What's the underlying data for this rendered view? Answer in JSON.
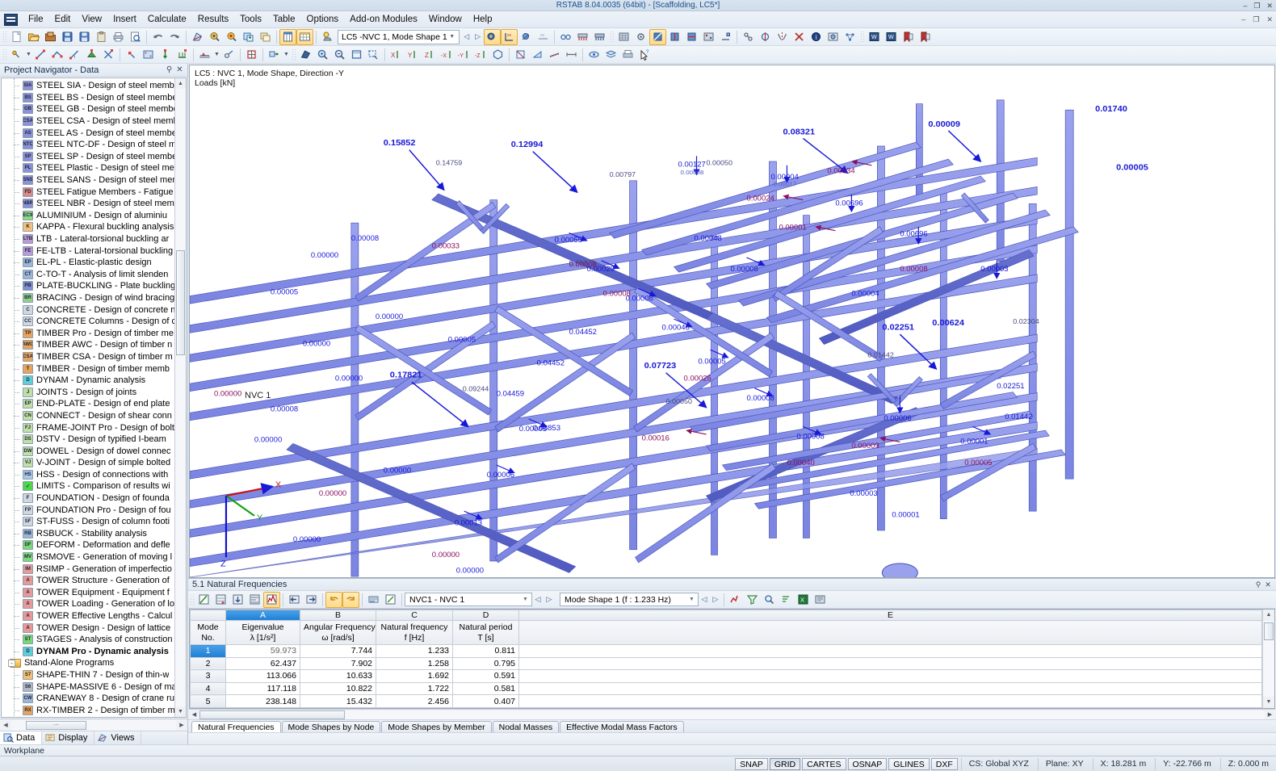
{
  "window": {
    "title": "RSTAB 8.04.0035 (64bit) - [Scaffolding, LC5*]",
    "minimize": "–",
    "maximize": "❐",
    "close": "✕",
    "doc_minimize": "–",
    "doc_maximize": "❐",
    "doc_close": "✕"
  },
  "menu": {
    "items": [
      {
        "label": "File"
      },
      {
        "label": "Edit"
      },
      {
        "label": "View"
      },
      {
        "label": "Insert"
      },
      {
        "label": "Calculate"
      },
      {
        "label": "Results"
      },
      {
        "label": "Tools"
      },
      {
        "label": "Table"
      },
      {
        "label": "Options"
      },
      {
        "label": "Add-on Modules"
      },
      {
        "label": "Window"
      },
      {
        "label": "Help"
      }
    ]
  },
  "toolbar_main": {
    "load_case_combo": "LC5 -NVC 1, Mode Shape 1",
    "buttons": [
      {
        "name": "new-document-icon"
      },
      {
        "name": "open-folder-icon"
      },
      {
        "name": "open-recent-icon"
      },
      {
        "name": "save-as-icon"
      },
      {
        "name": "save-icon"
      },
      {
        "name": "clipboard-icon"
      },
      {
        "name": "print-icon"
      },
      {
        "name": "print-preview-icon"
      },
      {
        "name": "undo-icon"
      },
      {
        "name": "redo-icon"
      },
      {
        "name": "render-icon"
      },
      {
        "name": "zoom-model-icon"
      },
      {
        "name": "zoom-results-icon"
      },
      {
        "name": "new-window-icon"
      },
      {
        "name": "cascade-icon"
      },
      {
        "name": "table-panel-icon"
      },
      {
        "name": "table-grid-icon"
      },
      {
        "name": "load-wizard-icon"
      }
    ]
  },
  "viewport": {
    "caption": "LC5 : NVC 1, Mode Shape, Direction -Y\nLoads [kN]",
    "mode_label": "NVC 1",
    "axes": {
      "x": "X",
      "y": "Y",
      "z": "Z"
    },
    "peak_labels": [
      "0.15852",
      "0.12994",
      "0.08321",
      "0.17821",
      "0.07723",
      "0.02251",
      "0.01740",
      "0.00696",
      "0.02251",
      "0.00624",
      "0.00624",
      "0.00005"
    ]
  },
  "sidebar": {
    "title": "Project Navigator - Data",
    "pin_icon": "⚲",
    "close_icon": "✕",
    "tabs": [
      {
        "label": "Data",
        "icon": "data-icon",
        "active": true
      },
      {
        "label": "Display",
        "icon": "display-icon",
        "active": false
      },
      {
        "label": "Views",
        "icon": "views-icon",
        "active": false
      }
    ],
    "items": [
      {
        "label": "STEEL SIA - Design of steel membe",
        "abbr": "SIA",
        "color": "#8a93d8",
        "level": 1
      },
      {
        "label": "STEEL BS - Design of steel membe",
        "abbr": "BS",
        "color": "#8a93d8",
        "level": 1
      },
      {
        "label": "STEEL GB - Design of steel membe",
        "abbr": "GB",
        "color": "#8a93d8",
        "level": 1
      },
      {
        "label": "STEEL CSA - Design of steel memb",
        "abbr": "CSA",
        "color": "#8a93d8",
        "level": 1
      },
      {
        "label": "STEEL AS - Design of steel membe",
        "abbr": "AS",
        "color": "#8a93d8",
        "level": 1
      },
      {
        "label": "STEEL NTC-DF - Design of steel m",
        "abbr": "NTC",
        "color": "#8a93d8",
        "level": 1
      },
      {
        "label": "STEEL SP - Design of steel membe",
        "abbr": "SP",
        "color": "#8a93d8",
        "level": 1
      },
      {
        "label": "STEEL Plastic - Design of steel mer",
        "abbr": "PL",
        "color": "#8a93d8",
        "level": 1
      },
      {
        "label": "STEEL SANS - Design of steel mem",
        "abbr": "SNS",
        "color": "#8a93d8",
        "level": 1
      },
      {
        "label": "STEEL Fatigue Members - Fatigue",
        "abbr": "FD",
        "color": "#d88a8a",
        "level": 1
      },
      {
        "label": "STEEL NBR - Design of steel memb",
        "abbr": "NBR",
        "color": "#8a93d8",
        "level": 1
      },
      {
        "label": "ALUMINIUM - Design of aluminiu",
        "abbr": "EC9",
        "color": "#8ad88a",
        "level": 1
      },
      {
        "label": "KAPPA - Flexural buckling analysis",
        "abbr": "K",
        "color": "#f2c27a",
        "level": 1
      },
      {
        "label": "LTB - Lateral-torsional buckling ar",
        "abbr": "LTB",
        "color": "#b99ad8",
        "level": 1
      },
      {
        "label": "FE-LTB - Lateral-torsional buckling",
        "abbr": "FE",
        "color": "#b99ad8",
        "level": 1
      },
      {
        "label": "EL-PL - Elastic-plastic design",
        "abbr": "EP",
        "color": "#9ab6d8",
        "level": 1
      },
      {
        "label": "C-TO-T - Analysis of limit slenden",
        "abbr": "CT",
        "color": "#9ab6d8",
        "level": 1
      },
      {
        "label": "PLATE-BUCKLING - Plate buckling",
        "abbr": "PB",
        "color": "#7f8fd0",
        "level": 1
      },
      {
        "label": "BRACING - Design of wind bracing",
        "abbr": "BR",
        "color": "#8fd08f",
        "level": 1
      },
      {
        "label": "CONCRETE - Design of concrete n",
        "abbr": "C",
        "color": "#cfd8e0",
        "level": 1
      },
      {
        "label": "CONCRETE Columns - Design of c",
        "abbr": "CC",
        "color": "#cfd8e0",
        "level": 1
      },
      {
        "label": "TIMBER Pro - Design of timber me",
        "abbr": "TP",
        "color": "#e8a45c",
        "level": 1
      },
      {
        "label": "TIMBER AWC - Design of timber n",
        "abbr": "AWC",
        "color": "#e8a45c",
        "level": 1
      },
      {
        "label": "TIMBER CSA - Design of timber m",
        "abbr": "CSA",
        "color": "#e8a45c",
        "level": 1
      },
      {
        "label": "TIMBER - Design of timber memb",
        "abbr": "T",
        "color": "#e8a45c",
        "level": 1
      },
      {
        "label": "DYNAM - Dynamic analysis",
        "abbr": "D",
        "color": "#5ecfd8",
        "level": 1
      },
      {
        "label": "JOINTS - Design of joints",
        "abbr": "J",
        "color": "#bfe0a8",
        "level": 1
      },
      {
        "label": "END-PLATE - Design of end plate",
        "abbr": "EP",
        "color": "#bfe0a8",
        "level": 1
      },
      {
        "label": "CONNECT - Design of shear conn",
        "abbr": "CN",
        "color": "#bfe0a8",
        "level": 1
      },
      {
        "label": "FRAME-JOINT Pro - Design of bolt",
        "abbr": "FJ",
        "color": "#bfe0a8",
        "level": 1
      },
      {
        "label": "DSTV - Design of typified I-beam",
        "abbr": "DS",
        "color": "#bfe0a8",
        "level": 1
      },
      {
        "label": "DOWEL - Design of dowel connec",
        "abbr": "DW",
        "color": "#bfe0a8",
        "level": 1
      },
      {
        "label": "V-JOINT - Design of simple bolted",
        "abbr": "VJ",
        "color": "#bfe0a8",
        "level": 1
      },
      {
        "label": "HSS - Design of connections with",
        "abbr": "HS",
        "color": "#a8c8e8",
        "level": 1
      },
      {
        "label": "LIMITS - Comparison of results wi",
        "abbr": "✓",
        "color": "#4ad84a",
        "level": 1
      },
      {
        "label": "FOUNDATION - Design of founda",
        "abbr": "F",
        "color": "#cfd8e0",
        "level": 1
      },
      {
        "label": "FOUNDATION Pro - Design of fou",
        "abbr": "FP",
        "color": "#cfd8e0",
        "level": 1
      },
      {
        "label": "ST-FUSS - Design of column footi",
        "abbr": "SF",
        "color": "#cfd8e0",
        "level": 1
      },
      {
        "label": "RSBUCK - Stability analysis",
        "abbr": "RB",
        "color": "#9ab6d8",
        "level": 1
      },
      {
        "label": "DEFORM - Deformation and defle",
        "abbr": "DF",
        "color": "#7ad87a",
        "level": 1
      },
      {
        "label": "RSMOVE - Generation of moving l",
        "abbr": "MV",
        "color": "#7ad87a",
        "level": 1
      },
      {
        "label": "RSIMP - Generation of imperfectio",
        "abbr": "IM",
        "color": "#e89a9a",
        "level": 1
      },
      {
        "label": "TOWER Structure - Generation of",
        "abbr": "A",
        "color": "#e89a9a",
        "level": 1
      },
      {
        "label": "TOWER Equipment - Equipment f",
        "abbr": "A",
        "color": "#e89a9a",
        "level": 1
      },
      {
        "label": "TOWER Loading - Generation of lo",
        "abbr": "A",
        "color": "#e89a9a",
        "level": 1
      },
      {
        "label": "TOWER Effective Lengths - Calcul",
        "abbr": "A",
        "color": "#e89a9a",
        "level": 1
      },
      {
        "label": "TOWER Design - Design of lattice",
        "abbr": "A",
        "color": "#e89a9a",
        "level": 1
      },
      {
        "label": "STAGES - Analysis of construction",
        "abbr": "ST",
        "color": "#7ad87a",
        "level": 1
      },
      {
        "label": "DYNAM Pro - Dynamic analysis",
        "abbr": "D",
        "color": "#5ecfd8",
        "level": 1,
        "bold": true
      },
      {
        "label": "Stand-Alone Programs",
        "folder": true,
        "level": 0,
        "expander": "-"
      },
      {
        "label": "SHAPE-THIN 7 - Design of thin-w",
        "abbr": "S7",
        "color": "#f0c070",
        "level": 1
      },
      {
        "label": "SHAPE-MASSIVE 6 - Design of ma",
        "abbr": "S6",
        "color": "#b0b8c4",
        "level": 1
      },
      {
        "label": "CRANEWAY 8 - Design of crane ru",
        "abbr": "CW",
        "color": "#9ab6d8",
        "level": 1
      },
      {
        "label": "RX-TIMBER 2 - Design of timber m",
        "abbr": "RX",
        "color": "#e8a45c",
        "level": 1
      }
    ],
    "hscroll_grip": "⋯"
  },
  "table_panel": {
    "title": "5.1 Natural Frequencies",
    "pin_icon": "⚲",
    "close_icon": "✕",
    "case_combo": "NVC1 - NVC 1",
    "mode_combo": "Mode Shape 1 (f : 1.233 Hz)",
    "prev_icon": "◁",
    "next_icon": "▷"
  },
  "chart_data": {
    "type": "table",
    "title": "5.1 Natural Frequencies",
    "column_letters": [
      "",
      "A",
      "B",
      "C",
      "D",
      "E"
    ],
    "headers": [
      {
        "top": "Mode",
        "bottom": "No."
      },
      {
        "top": "Eigenvalue",
        "bottom": "λ [1/s²]"
      },
      {
        "top": "Angular Frequency",
        "bottom": "ω [rad/s]"
      },
      {
        "top": "Natural frequency",
        "bottom": "f [Hz]"
      },
      {
        "top": "Natural period",
        "bottom": "T [s]"
      },
      {
        "top": "",
        "bottom": ""
      }
    ],
    "rows": [
      {
        "mode": "1",
        "eigenvalue": "59.973",
        "angular": "7.744",
        "frequency": "1.233",
        "period": "0.811",
        "selected": true
      },
      {
        "mode": "2",
        "eigenvalue": "62.437",
        "angular": "7.902",
        "frequency": "1.258",
        "period": "0.795",
        "selected": false
      },
      {
        "mode": "3",
        "eigenvalue": "113.066",
        "angular": "10.633",
        "frequency": "1.692",
        "period": "0.591",
        "selected": false
      },
      {
        "mode": "4",
        "eigenvalue": "117.118",
        "angular": "10.822",
        "frequency": "1.722",
        "period": "0.581",
        "selected": false
      },
      {
        "mode": "5",
        "eigenvalue": "238.148",
        "angular": "15.432",
        "frequency": "2.456",
        "period": "0.407",
        "selected": false
      }
    ]
  },
  "sheet_tabs": [
    {
      "label": "Natural Frequencies",
      "active": true
    },
    {
      "label": "Mode Shapes by Node",
      "active": false
    },
    {
      "label": "Mode Shapes by Member",
      "active": false
    },
    {
      "label": "Nodal Masses",
      "active": false
    },
    {
      "label": "Effective Modal Mass Factors",
      "active": false
    }
  ],
  "status": {
    "workplane": "Workplane",
    "chips": [
      {
        "label": "SNAP",
        "pressed": false
      },
      {
        "label": "GRID",
        "pressed": true
      },
      {
        "label": "CARTES",
        "pressed": false
      },
      {
        "label": "OSNAP",
        "pressed": false
      },
      {
        "label": "GLINES",
        "pressed": false
      },
      {
        "label": "DXF",
        "pressed": false
      }
    ],
    "cs": "CS: Global XYZ",
    "plane": "Plane: XY",
    "x": "X:  18.281 m",
    "y": "Y:  -22.766 m",
    "z": "Z:  0.000 m"
  }
}
